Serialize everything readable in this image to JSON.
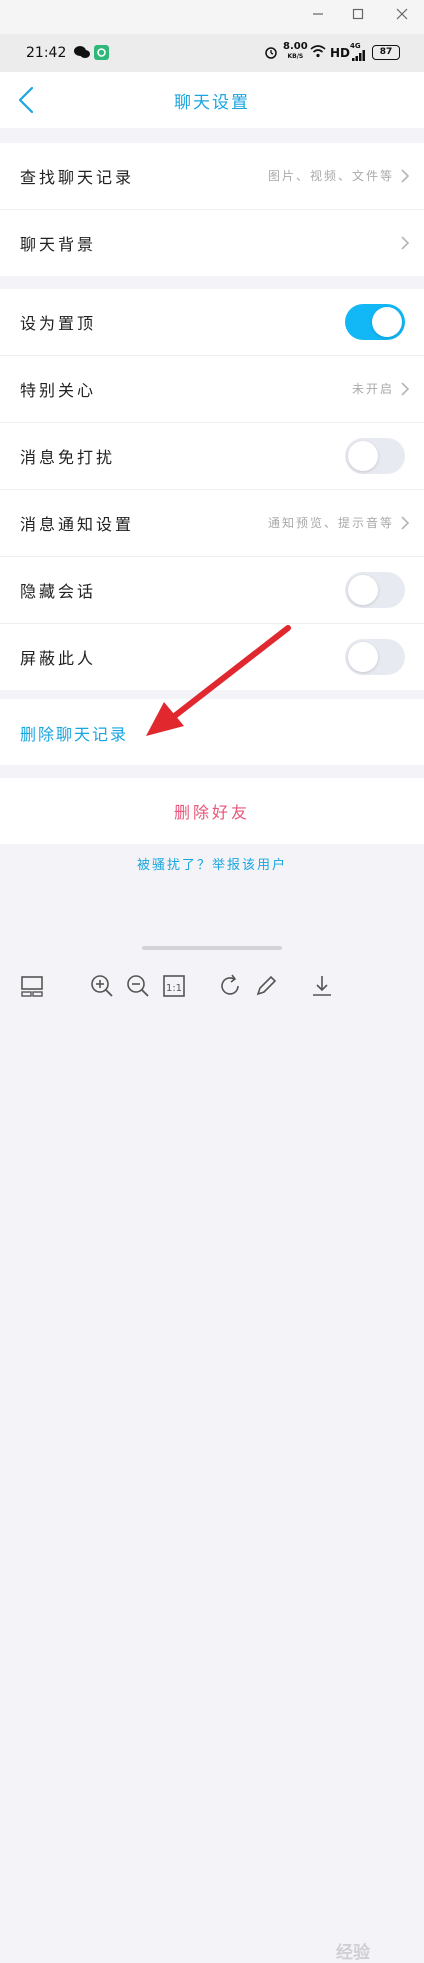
{
  "status_bar": {
    "time": "21:42",
    "speed": "8.00",
    "speed_unit": "KB/S",
    "network": "HD",
    "signal": "4G",
    "battery": "87"
  },
  "nav": {
    "title": "聊天设置"
  },
  "group1": [
    {
      "label": "查找聊天记录",
      "value": "图片、视频、文件等"
    },
    {
      "label": "聊天背景",
      "value": ""
    }
  ],
  "group2": {
    "pin": {
      "label": "设为置顶",
      "on": true
    },
    "special_care": {
      "label": "特别关心",
      "value": "未开启"
    },
    "dnd": {
      "label": "消息免打扰",
      "on": false
    },
    "notify": {
      "label": "消息通知设置",
      "value": "通知预览、提示音等"
    },
    "hide": {
      "label": "隐藏会话",
      "on": false
    },
    "block": {
      "label": "屏蔽此人",
      "on": false
    }
  },
  "actions": {
    "delete_record": "删除聊天记录",
    "delete_friend": "删除好友",
    "report": "被骚扰了？举报该用户"
  },
  "watermark": "经验",
  "colors": {
    "accent": "#1aa5e0",
    "toggle_on": "#12b7f5",
    "danger": "#e8567a",
    "arrow": "#e0282e"
  }
}
